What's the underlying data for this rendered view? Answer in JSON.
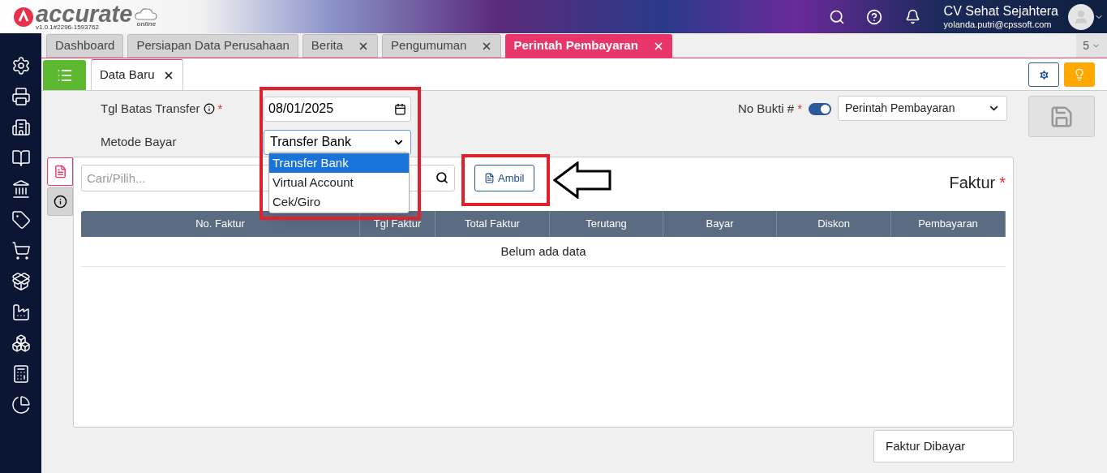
{
  "header": {
    "logo_text": "accurate",
    "logo_sub": "online",
    "version": "v1.0.1#2296-1593762",
    "company": "CV Sehat Sejahtera",
    "email": "yolanda.putri@cpssoft.com"
  },
  "tabs": [
    {
      "label": "Dashboard",
      "selected": false,
      "closable": false
    },
    {
      "label": "Persiapan Data Perusahaan",
      "selected": false,
      "closable": false
    },
    {
      "label": "Berita",
      "selected": false,
      "closable": true
    },
    {
      "label": "Pengumuman",
      "selected": false,
      "closable": true
    },
    {
      "label": "Perintah Pembayaran",
      "selected": true,
      "closable": true
    }
  ],
  "tab_count": "5",
  "sub_tabs": [
    {
      "label": "Data Baru",
      "selected": true
    }
  ],
  "form": {
    "tgl_label": "Tgl Batas Transfer",
    "tgl_required": "*",
    "tgl_value": "08/01/2025",
    "metode_label": "Metode Bayar",
    "metode_value": "Transfer Bank",
    "no_bukti_label": "No Bukti #",
    "no_bukti_required": "*",
    "no_bukti_on": true,
    "no_bukti_value": "Perintah Pembayaran"
  },
  "dropdown": [
    {
      "label": "Transfer Bank",
      "selected": true
    },
    {
      "label": "Virtual Account",
      "selected": false
    },
    {
      "label": "Cek/Giro",
      "selected": false
    }
  ],
  "search": {
    "placeholder": "Cari/Pilih..."
  },
  "ambil_button": "Ambil",
  "section_title": "Faktur",
  "section_required": "*",
  "table": {
    "columns": [
      "No. Faktur",
      "Tgl Faktur",
      "Total Faktur",
      "Terutang",
      "Bayar",
      "Diskon",
      "Pembayaran"
    ],
    "empty": "Belum ada data"
  },
  "bottom_tab": "Faktur Dibayar"
}
